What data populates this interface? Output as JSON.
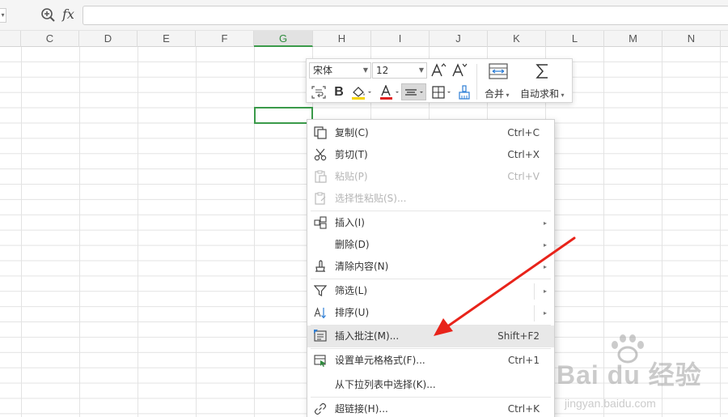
{
  "formula_bar": {
    "fx": "fx",
    "value": ""
  },
  "columns": [
    "C",
    "D",
    "E",
    "F",
    "G",
    "H",
    "I",
    "J",
    "K",
    "L",
    "M",
    "N"
  ],
  "selected_column": "G",
  "toolbar": {
    "font_name": "宋体",
    "font_size": "12",
    "merge_label": "合并",
    "autosum_label": "自动求和",
    "font_color": "#e02020",
    "fill_color": "#f5d400",
    "accent": "#3a9a4a"
  },
  "context_menu": {
    "items": [
      {
        "icon": "copy-icon",
        "label": "复制(C)",
        "shortcut": "Ctrl+C",
        "disabled": false
      },
      {
        "icon": "scissors-icon",
        "label": "剪切(T)",
        "shortcut": "Ctrl+X",
        "disabled": false
      },
      {
        "icon": "paste-icon",
        "label": "粘贴(P)",
        "shortcut": "Ctrl+V",
        "disabled": true
      },
      {
        "icon": "paste-special-icon",
        "label": "选择性粘贴(S)...",
        "shortcut": "",
        "disabled": true
      },
      {
        "icon": "insert-cells-icon",
        "label": "插入(I)",
        "shortcut": "",
        "submenu": true
      },
      {
        "icon": "",
        "label": "删除(D)",
        "shortcut": "",
        "submenu": true
      },
      {
        "icon": "eraser-icon",
        "label": "清除内容(N)",
        "shortcut": "",
        "submenu": true
      },
      {
        "icon": "filter-icon",
        "label": "筛选(L)",
        "shortcut": "",
        "submenu": true
      },
      {
        "icon": "sort-icon",
        "label": "排序(U)",
        "shortcut": "",
        "submenu": true
      },
      {
        "icon": "comment-icon",
        "label": "插入批注(M)...",
        "shortcut": "Shift+F2",
        "highlighted": true
      },
      {
        "icon": "format-cells-icon",
        "label": "设置单元格格式(F)...",
        "shortcut": "Ctrl+1"
      },
      {
        "icon": "",
        "label": "从下拉列表中选择(K)...",
        "shortcut": ""
      },
      {
        "icon": "link-icon",
        "label": "超链接(H)...",
        "shortcut": "Ctrl+K"
      }
    ],
    "submenu_glyph": "▸"
  },
  "annotation_color": "#e8231a",
  "watermark": {
    "main": "Bai du 经验",
    "sub": "jingyan.baidu.com"
  }
}
